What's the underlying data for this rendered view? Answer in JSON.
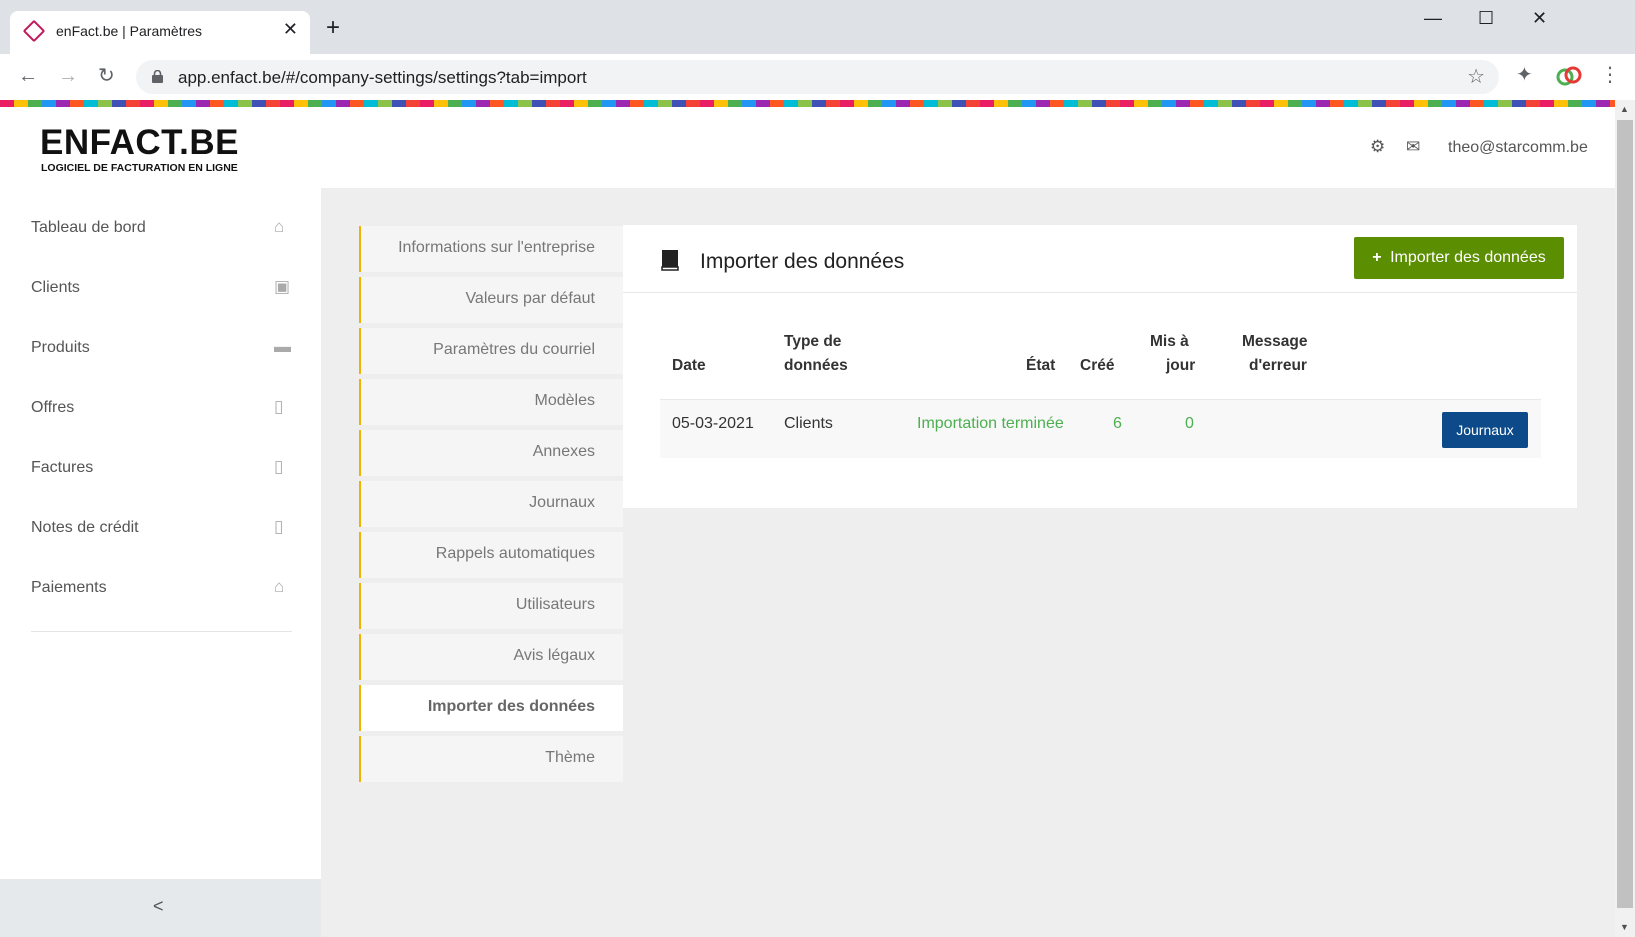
{
  "browser": {
    "tab_title": "enFact.be | Paramètres",
    "tab_close": "✕",
    "new_tab": "+",
    "url": "app.enfact.be/#/company-settings/settings?tab=import",
    "win_minimize": "—",
    "win_maximize": "☐",
    "win_close": "✕",
    "back": "←",
    "forward": "→",
    "reload": "↻",
    "star": "☆",
    "ext": "✦",
    "menu": "⋮",
    "scroll_up": "▲",
    "scroll_down": "▼"
  },
  "header": {
    "logo": "ENFACT.BE",
    "logo_sub": "LOGICIEL DE FACTURATION EN LIGNE",
    "settings_glyph": "⚙",
    "mail_glyph": "✉",
    "user": "theo@starcomm.be"
  },
  "sidebar": {
    "items": [
      {
        "label": "Tableau de bord",
        "icon": "home-icon",
        "glyph": "⌂"
      },
      {
        "label": "Clients",
        "icon": "contacts-icon",
        "glyph": "▣"
      },
      {
        "label": "Produits",
        "icon": "products-icon",
        "glyph": "▬"
      },
      {
        "label": "Offres",
        "icon": "pdf-icon",
        "glyph": "▯"
      },
      {
        "label": "Factures",
        "icon": "pdf-icon",
        "glyph": "▯"
      },
      {
        "label": "Notes de crédit",
        "icon": "pdf-icon",
        "glyph": "▯"
      },
      {
        "label": "Paiements",
        "icon": "bank-icon",
        "glyph": "⌂"
      }
    ],
    "collapse": "<"
  },
  "settings_menu": {
    "items": [
      "Informations sur l'entreprise",
      "Valeurs par défaut",
      "Paramètres du courriel",
      "Modèles",
      "Annexes",
      "Journaux",
      "Rappels automatiques",
      "Utilisateurs",
      "Avis légaux",
      "Importer des données",
      "Thème"
    ],
    "active": "Importer des données"
  },
  "panel": {
    "title": "Importer des données",
    "import_button": "Importer des données",
    "import_plus": "+",
    "columns": {
      "date": "Date",
      "type_1": "Type de",
      "type_2": "données",
      "state": "État",
      "created": "Créé",
      "updated_1": "Mis à",
      "updated_2": "jour",
      "error_1": "Message",
      "error_2": "d'erreur"
    },
    "rows": [
      {
        "date": "05-03-2021",
        "type": "Clients",
        "state": "Importation terminée",
        "created": "6",
        "updated": "0",
        "error": "",
        "action": "Journaux"
      }
    ]
  }
}
